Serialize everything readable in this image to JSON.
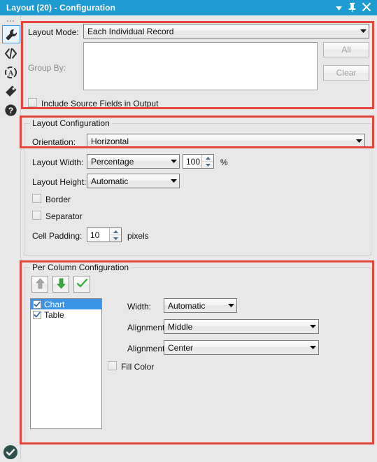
{
  "window": {
    "title": "Layout (20) - Configuration",
    "titlebar_color": "#1e9bd0",
    "buttons": {
      "menu_caret": "▾",
      "pin": "pin-icon",
      "close": "✕"
    }
  },
  "rail": {
    "items": [
      {
        "name": "configuration-wrench",
        "selected": true
      },
      {
        "name": "xml-code",
        "selected": false
      },
      {
        "name": "annotation",
        "selected": false
      },
      {
        "name": "label-tag",
        "selected": false
      },
      {
        "name": "help-question",
        "selected": false
      }
    ],
    "status_icon": "check-circle"
  },
  "annotations": {
    "highlight_color": "#e8453c",
    "boxes": 3
  },
  "layout_mode_section": {
    "layout_mode_label": "Layout Mode:",
    "layout_mode_value": "Each Individual Record",
    "group_by_label": "Group By:",
    "group_by_value": "",
    "all_button": "All",
    "clear_button": "Clear",
    "include_source_fields_label": "Include Source Fields in Output",
    "include_source_fields_checked": false
  },
  "layout_configuration": {
    "group_title": "Layout Configuration",
    "orientation_label": "Orientation:",
    "orientation_value": "Horizontal",
    "layout_width_label": "Layout Width:",
    "layout_width_value": "Percentage",
    "layout_width_amount": "100",
    "layout_width_unit": "%",
    "layout_height_label": "Layout Height:",
    "layout_height_value": "Automatic",
    "border_label": "Border",
    "border_checked": false,
    "separator_label": "Separator",
    "separator_checked": false,
    "cell_padding_label": "Cell Padding:",
    "cell_padding_value": "10",
    "cell_padding_unit": "pixels"
  },
  "per_column_configuration": {
    "group_title": "Per Column Configuration",
    "toolbar": {
      "move_up": "move-up-arrow",
      "move_down": "move-down-arrow",
      "apply": "apply-check"
    },
    "columns": [
      {
        "label": "Chart",
        "checked": true,
        "selected": true
      },
      {
        "label": "Table",
        "checked": true,
        "selected": false
      }
    ],
    "width_label": "Width:",
    "width_value": "Automatic",
    "alignment_v_label": "Alignment (V):",
    "alignment_v_value": "Middle",
    "alignment_h_label": "Alignment (H):",
    "alignment_h_value": "Center",
    "fill_color_label": "Fill Color",
    "fill_color_checked": false
  }
}
